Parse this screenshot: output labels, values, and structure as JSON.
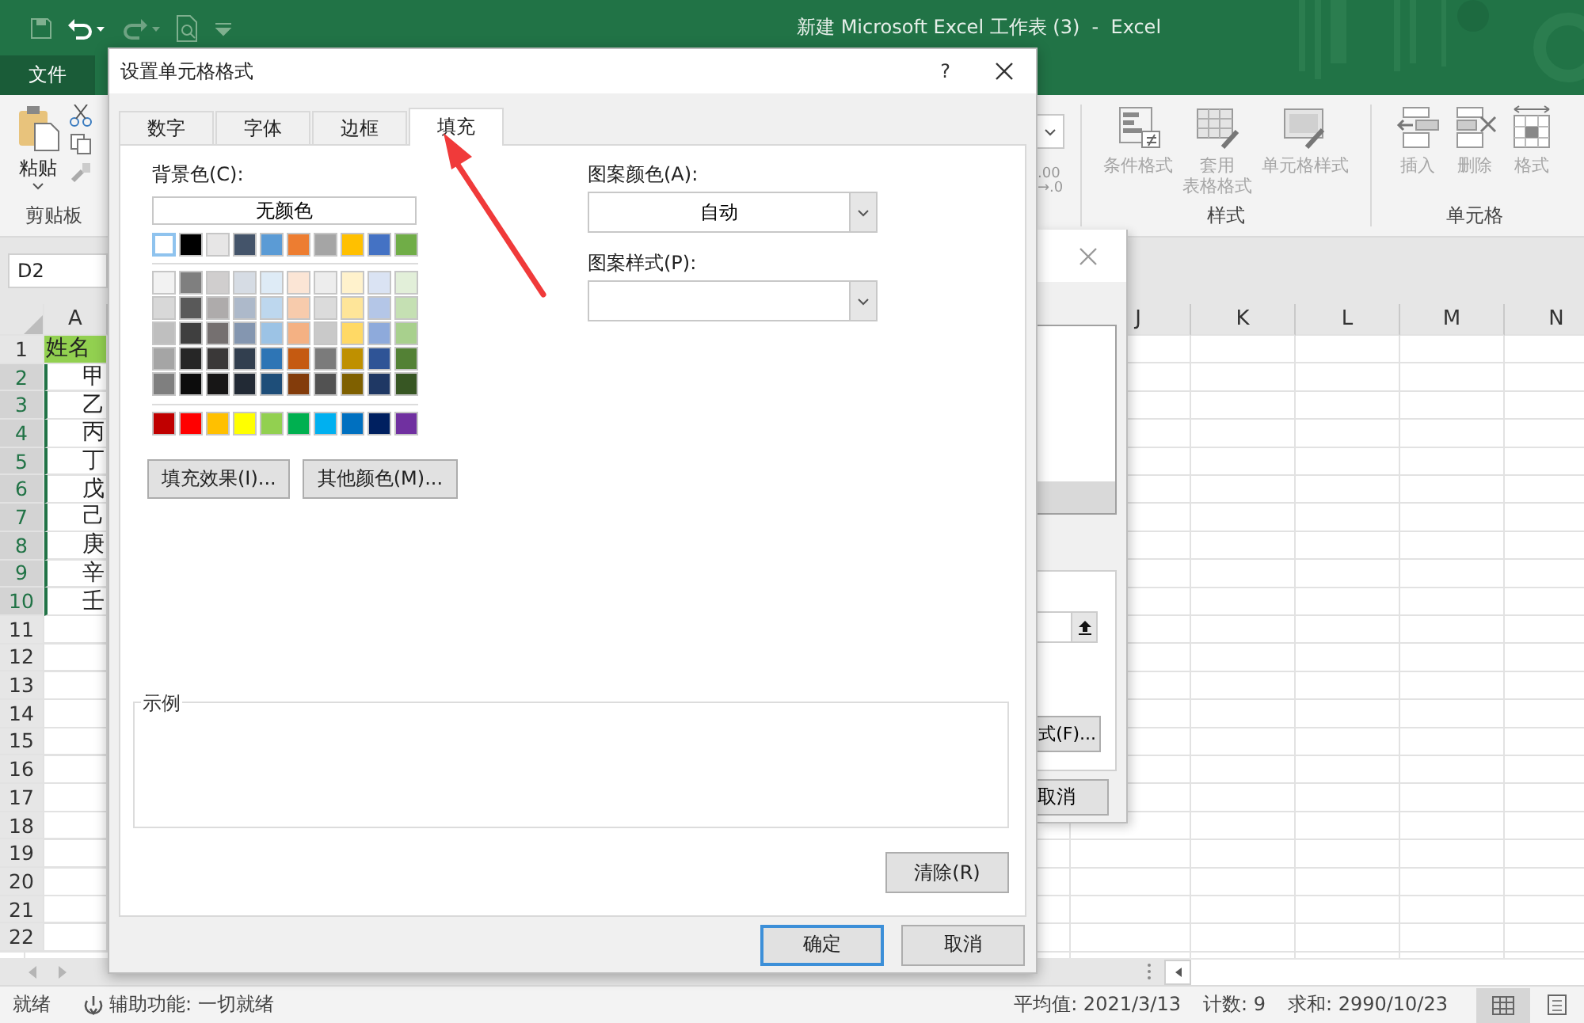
{
  "window": {
    "title": "新建 Microsoft Excel 工作表 (3)  -  Excel"
  },
  "file_tab": "文件",
  "ribbon": {
    "paste": "粘贴",
    "clipboard_group": "剪贴板",
    "number_partial": [
      ".00",
      "→.0"
    ],
    "styles_group": "样式",
    "styles_buttons": [
      {
        "kind": "conditional",
        "lines": [
          "条件格式"
        ],
        "disabled": true
      },
      {
        "kind": "table",
        "lines": [
          "套用",
          "表格格式"
        ],
        "disabled": true
      },
      {
        "kind": "cellstyle",
        "lines": [
          "单元格样式"
        ],
        "disabled": true
      }
    ],
    "cells_group": "单元格",
    "cells_buttons": [
      {
        "kind": "insert",
        "lines": [
          "插入"
        ],
        "disabled": true
      },
      {
        "kind": "delete",
        "lines": [
          "删除"
        ],
        "disabled": true
      },
      {
        "kind": "format",
        "lines": [
          "格式"
        ],
        "disabled": true
      }
    ]
  },
  "name_box": "D2",
  "columns": [
    "A",
    "J",
    "K",
    "L",
    "M",
    "N"
  ],
  "rows": [
    {
      "number": "1",
      "value": "姓名",
      "filled": true,
      "selected": false
    },
    {
      "number": "2",
      "value": "甲",
      "filled": false,
      "selected": true
    },
    {
      "number": "3",
      "value": "乙",
      "filled": false,
      "selected": true
    },
    {
      "number": "4",
      "value": "丙",
      "filled": false,
      "selected": true
    },
    {
      "number": "5",
      "value": "丁",
      "filled": false,
      "selected": true
    },
    {
      "number": "6",
      "value": "戊",
      "filled": false,
      "selected": true
    },
    {
      "number": "7",
      "value": "己",
      "filled": false,
      "selected": true
    },
    {
      "number": "8",
      "value": "庚",
      "filled": false,
      "selected": true
    },
    {
      "number": "9",
      "value": "辛",
      "filled": false,
      "selected": true
    },
    {
      "number": "10",
      "value": "壬",
      "filled": false,
      "selected": true
    },
    {
      "number": "11",
      "value": "",
      "filled": false,
      "selected": false
    },
    {
      "number": "12",
      "value": "",
      "filled": false,
      "selected": false
    },
    {
      "number": "13",
      "value": "",
      "filled": false,
      "selected": false
    },
    {
      "number": "14",
      "value": "",
      "filled": false,
      "selected": false
    },
    {
      "number": "15",
      "value": "",
      "filled": false,
      "selected": false
    },
    {
      "number": "16",
      "value": "",
      "filled": false,
      "selected": false
    },
    {
      "number": "17",
      "value": "",
      "filled": false,
      "selected": false
    },
    {
      "number": "18",
      "value": "",
      "filled": false,
      "selected": false
    },
    {
      "number": "19",
      "value": "",
      "filled": false,
      "selected": false
    },
    {
      "number": "20",
      "value": "",
      "filled": false,
      "selected": false
    },
    {
      "number": "21",
      "value": "",
      "filled": false,
      "selected": false
    },
    {
      "number": "22",
      "value": "",
      "filled": false,
      "selected": false
    }
  ],
  "back_dialog": {
    "button_partial": "式(F)...",
    "cancel": "取消"
  },
  "dialog": {
    "title": "设置单元格格式",
    "help": "?",
    "tabs": [
      {
        "label": "数字",
        "selected": false
      },
      {
        "label": "字体",
        "selected": false
      },
      {
        "label": "边框",
        "selected": false
      },
      {
        "label": "填充",
        "selected": true
      }
    ],
    "background_label": "背景色(C):",
    "no_color": "无颜色",
    "theme_colors": [
      {
        "color": "#ffffff",
        "selected": true
      },
      {
        "color": "#000000",
        "selected": false
      },
      {
        "color": "#e7e6e6",
        "selected": false
      },
      {
        "color": "#44546a",
        "selected": false
      },
      {
        "color": "#5b9bd5",
        "selected": false
      },
      {
        "color": "#ed7d31",
        "selected": false
      },
      {
        "color": "#a5a5a5",
        "selected": false
      },
      {
        "color": "#ffc000",
        "selected": false
      },
      {
        "color": "#4472c4",
        "selected": false
      },
      {
        "color": "#70ad47",
        "selected": false
      }
    ],
    "shade_rows": [
      {
        "swatches": [
          {
            "color": "#f2f2f2",
            "selected": false
          },
          {
            "color": "#7f7f7f",
            "selected": false
          },
          {
            "color": "#d0cece",
            "selected": false
          },
          {
            "color": "#d6dce4",
            "selected": false
          },
          {
            "color": "#deebf6",
            "selected": false
          },
          {
            "color": "#fbe5d5",
            "selected": false
          },
          {
            "color": "#ededed",
            "selected": false
          },
          {
            "color": "#fff2cc",
            "selected": false
          },
          {
            "color": "#dae3f3",
            "selected": false
          },
          {
            "color": "#e2efd9",
            "selected": false
          }
        ]
      },
      {
        "swatches": [
          {
            "color": "#d8d8d8",
            "selected": false
          },
          {
            "color": "#595959",
            "selected": false
          },
          {
            "color": "#aeabab",
            "selected": false
          },
          {
            "color": "#adb9ca",
            "selected": false
          },
          {
            "color": "#bdd7ee",
            "selected": false
          },
          {
            "color": "#f7cbac",
            "selected": false
          },
          {
            "color": "#dbdbdb",
            "selected": false
          },
          {
            "color": "#fee599",
            "selected": false
          },
          {
            "color": "#b4c6e7",
            "selected": false
          },
          {
            "color": "#c5e0b3",
            "selected": false
          }
        ]
      },
      {
        "swatches": [
          {
            "color": "#bfbfbf",
            "selected": false
          },
          {
            "color": "#3f3f3f",
            "selected": false
          },
          {
            "color": "#757070",
            "selected": false
          },
          {
            "color": "#8496b0",
            "selected": false
          },
          {
            "color": "#9cc3e5",
            "selected": false
          },
          {
            "color": "#f4b183",
            "selected": false
          },
          {
            "color": "#c9c9c9",
            "selected": false
          },
          {
            "color": "#ffd965",
            "selected": false
          },
          {
            "color": "#8eaadb",
            "selected": false
          },
          {
            "color": "#a8d08d",
            "selected": false
          }
        ]
      },
      {
        "swatches": [
          {
            "color": "#a5a5a5",
            "selected": false
          },
          {
            "color": "#262626",
            "selected": false
          },
          {
            "color": "#3a3838",
            "selected": false
          },
          {
            "color": "#323f4f",
            "selected": false
          },
          {
            "color": "#2e75b5",
            "selected": false
          },
          {
            "color": "#c55a11",
            "selected": false
          },
          {
            "color": "#7b7b7b",
            "selected": false
          },
          {
            "color": "#bf9000",
            "selected": false
          },
          {
            "color": "#2f5496",
            "selected": false
          },
          {
            "color": "#538135",
            "selected": false
          }
        ]
      },
      {
        "swatches": [
          {
            "color": "#7f7f7f",
            "selected": false
          },
          {
            "color": "#0c0c0c",
            "selected": false
          },
          {
            "color": "#171616",
            "selected": false
          },
          {
            "color": "#222a35",
            "selected": false
          },
          {
            "color": "#1e4e79",
            "selected": false
          },
          {
            "color": "#833c0b",
            "selected": false
          },
          {
            "color": "#525252",
            "selected": false
          },
          {
            "color": "#7f6000",
            "selected": false
          },
          {
            "color": "#1f3864",
            "selected": false
          },
          {
            "color": "#375623",
            "selected": false
          }
        ]
      }
    ],
    "standard_colors": [
      {
        "color": "#c00000",
        "selected": false
      },
      {
        "color": "#ff0000",
        "selected": false
      },
      {
        "color": "#ffc000",
        "selected": false
      },
      {
        "color": "#ffff00",
        "selected": false
      },
      {
        "color": "#92d050",
        "selected": false
      },
      {
        "color": "#00b050",
        "selected": false
      },
      {
        "color": "#00b0f0",
        "selected": false
      },
      {
        "color": "#0070c0",
        "selected": false
      },
      {
        "color": "#002060",
        "selected": false
      },
      {
        "color": "#7030a0",
        "selected": false
      }
    ],
    "effect_buttons": [
      "填充效果(I)...",
      "其他颜色(M)..."
    ],
    "pattern_color": {
      "label": "图案颜色(A):",
      "value": "自动"
    },
    "pattern_style": {
      "label": "图案样式(P):"
    },
    "sample_label": "示例",
    "clear": "清除(R)",
    "ok": "确定",
    "cancel": "取消"
  },
  "status_bar": {
    "ready": "就绪",
    "accessibility": "辅助功能: 一切就绪",
    "average": "平均值: 2021/3/13",
    "count": "计数: 9",
    "sum": "求和: 2990/10/23",
    "views": [
      {
        "kind": "normal",
        "selected": true
      },
      {
        "kind": "page-layout",
        "selected": false
      }
    ]
  }
}
